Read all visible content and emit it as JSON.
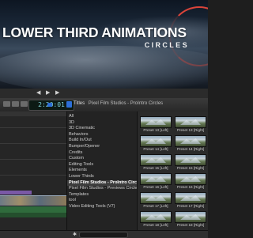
{
  "viewer": {
    "headline": "LOWER THIRD ANIMATIONS",
    "subheadline": "CIRCLES"
  },
  "toolbar": {
    "timecode": "2:20:01"
  },
  "panel": {
    "section": "Titles",
    "breadcrumb": "Pixel Film Studios - ProIntro Circles"
  },
  "browser": {
    "categories": [
      "All",
      "3D",
      "3D Cinematic",
      "Behaviors",
      "Build In/Out",
      "Bumper/Opener",
      "Credits",
      "Custom",
      "Editing Tools",
      "Elements",
      "Lower Thirds",
      "Pixel Film Studios - ProIntro Circles",
      "Pixel Film Studios - Previews Circles",
      "Templates",
      "tool",
      "Video Editing Tools (V7)"
    ],
    "selected_index": 11,
    "thumbnails": [
      "Preset 13 [Left]",
      "Preset 13 [Right]",
      "Preset 14 [Left]",
      "Preset 14 [Right]",
      "Preset 15 [Left]",
      "Preset 15 [Right]",
      "Preset 16 [Left]",
      "Preset 16 [Right]",
      "Preset 17 [Left]",
      "Preset 17 [Right]",
      "Preset 18 [Left]",
      "Preset 18 [Right]"
    ]
  },
  "colors": {
    "accent_ring": "#d9443a",
    "timecode": "#7fd0d6",
    "selection": "#2d6fd8"
  }
}
